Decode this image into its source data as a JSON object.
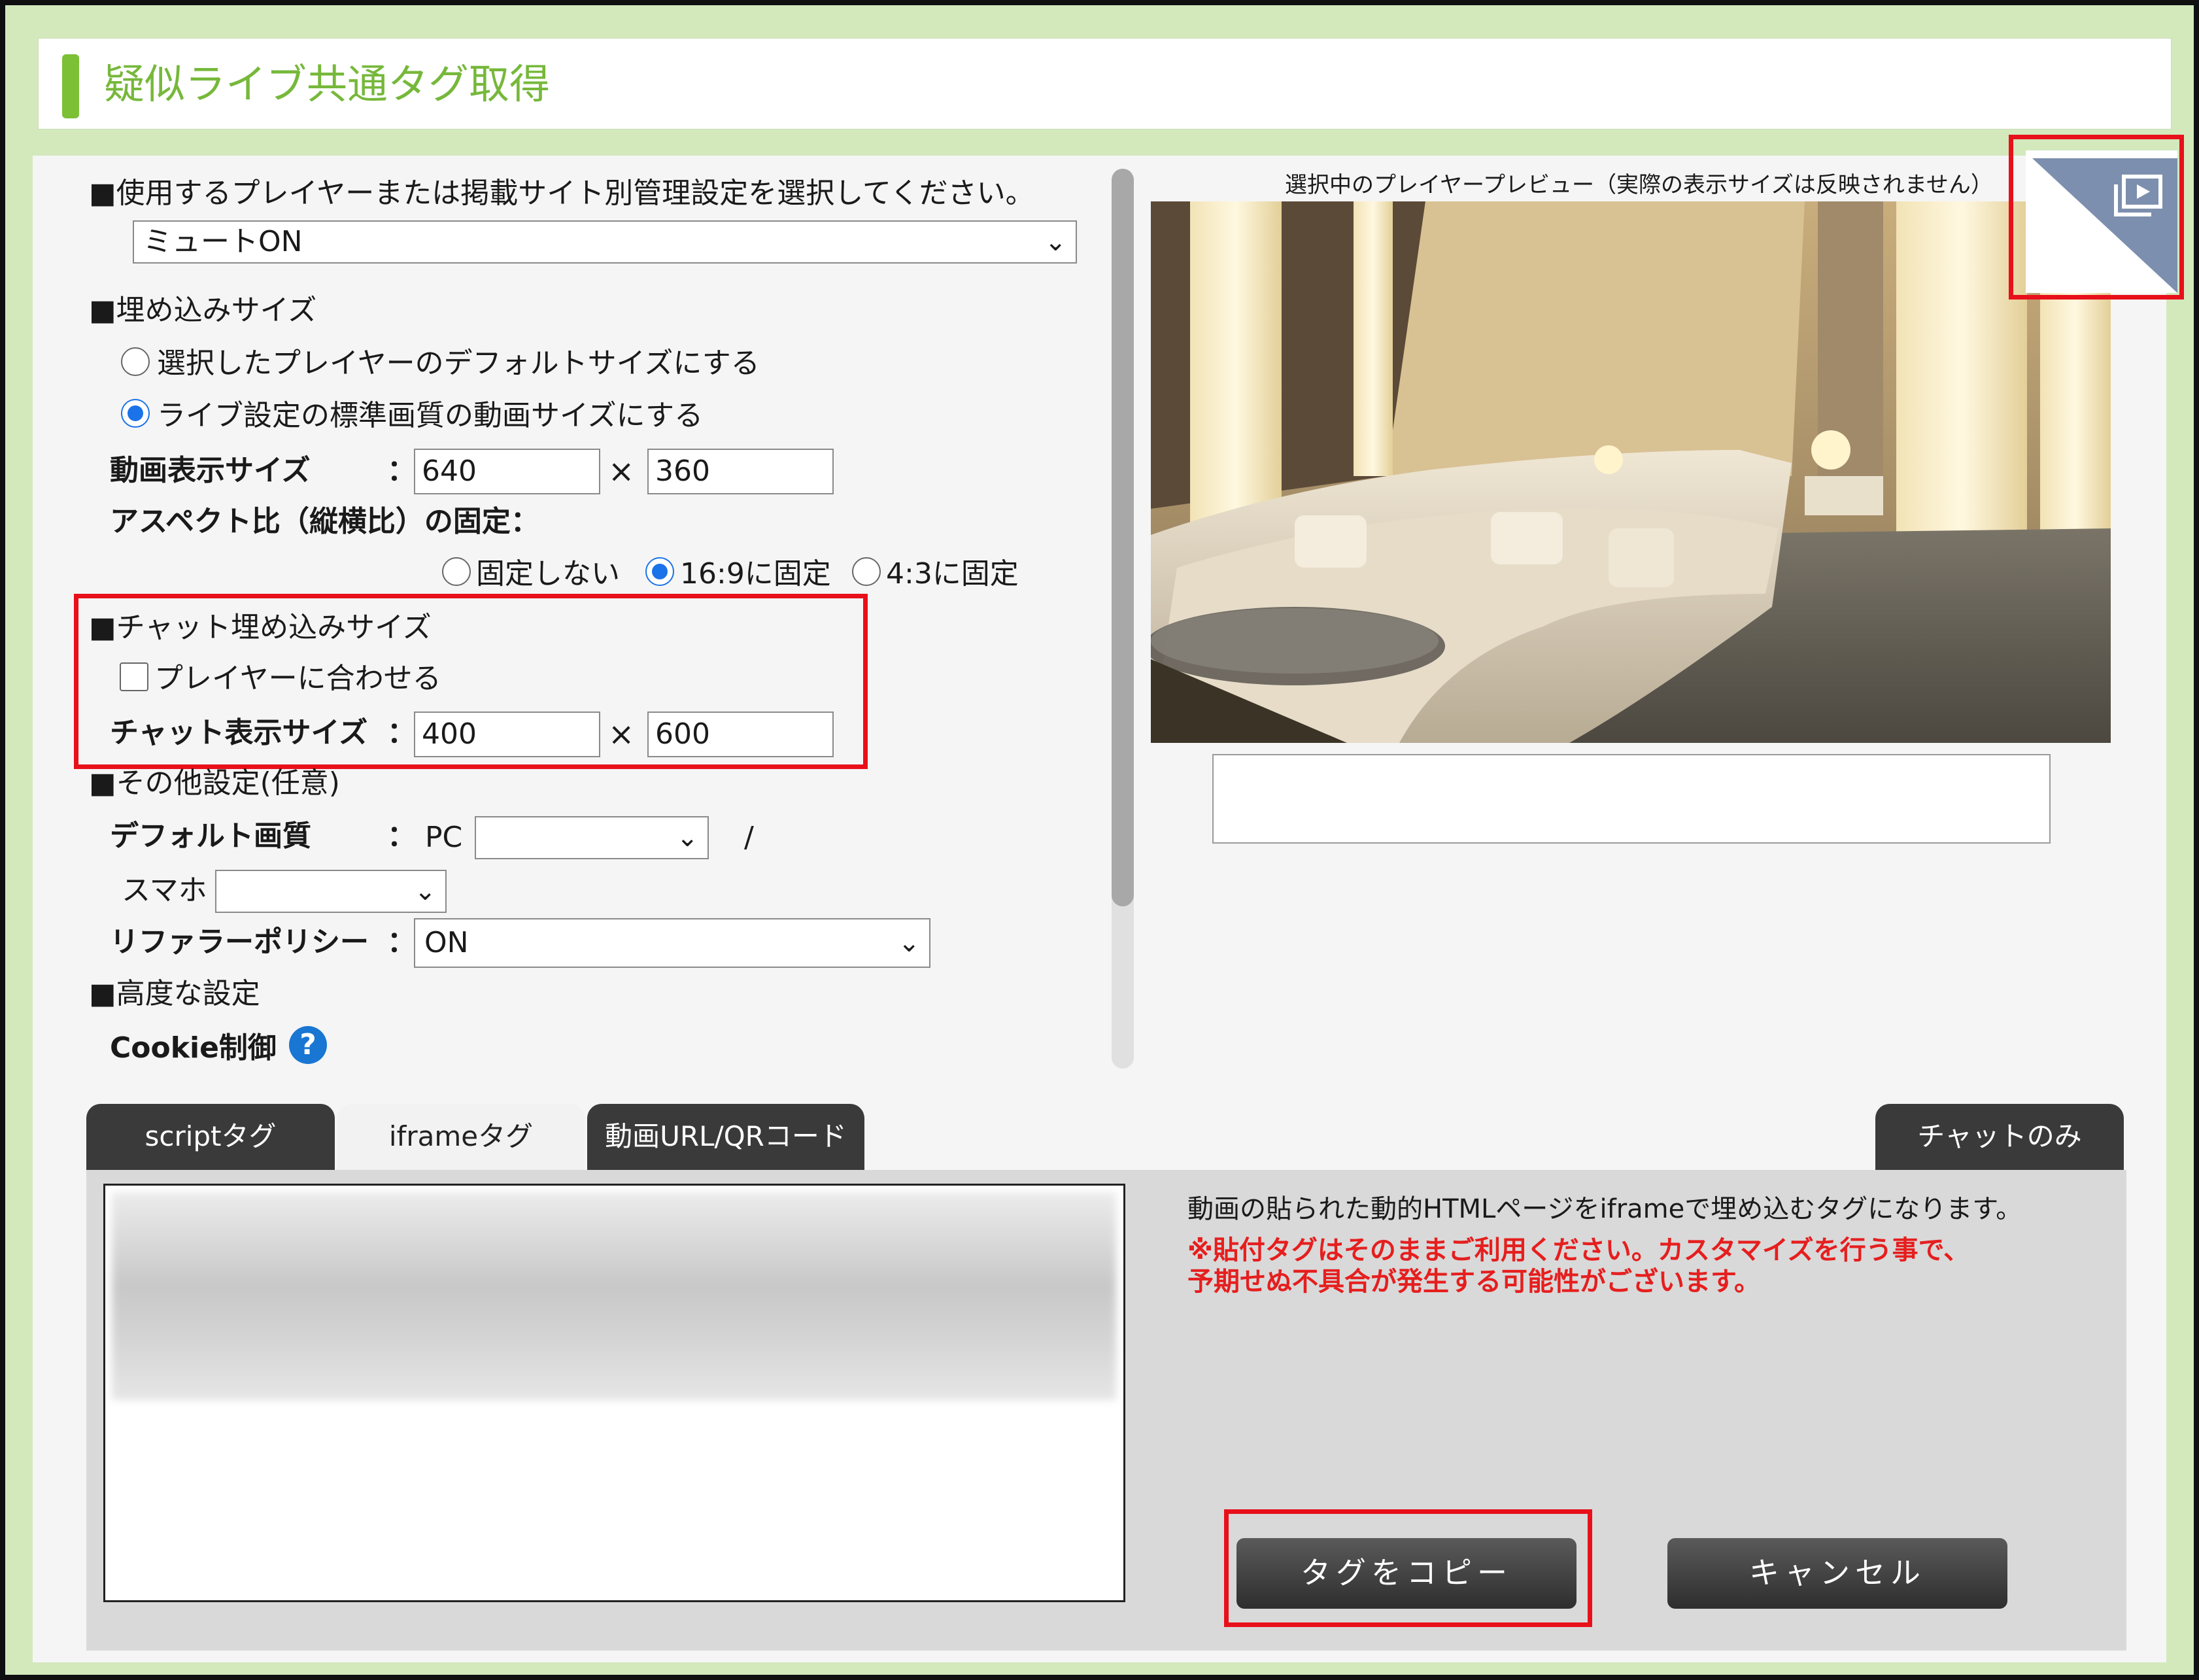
{
  "page": {
    "title": "疑似ライブ共通タグ取得"
  },
  "settings": {
    "player_heading": "■使用するプレイヤーまたは掲載サイト別管理設定を選択してください。",
    "player_select": "ミュートON",
    "embed_heading": "■埋め込みサイズ",
    "size_option_default": "選択したプレイヤーのデフォルトサイズにする",
    "size_option_live": "ライブ設定の標準画質の動画サイズにする",
    "video_size_label": "動画表示サイズ",
    "colon": "：",
    "times": "×",
    "video_width": "640",
    "video_height": "360",
    "aspect_label": "アスペクト比（縦横比）の固定：",
    "aspect_none": "固定しない",
    "aspect_169": "16:9に固定",
    "aspect_43": "4:3に固定",
    "chat_heading": "■チャット埋め込みサイズ",
    "chat_fit_label": "プレイヤーに合わせる",
    "chat_size_label": "チャット表示サイズ",
    "chat_width": "400",
    "chat_height": "600",
    "other_heading": "■その他設定(任意)",
    "default_quality_label": "デフォルト画質",
    "pc_label": "PC",
    "pc_select": "",
    "slash": "/",
    "smartphone_label": "スマホ",
    "smartphone_select": "",
    "referrer_label": "リファラーポリシー",
    "referrer_select": "ON",
    "advanced_heading": "■高度な設定",
    "cookie_label": "Cookie制御",
    "help_glyph": "?"
  },
  "preview": {
    "label": "選択中のプレイヤープレビュー（実際の表示サイズは反映されません）",
    "caption": "",
    "corner_icon": "playlist-play-icon"
  },
  "tabs": [
    {
      "label": "scriptタグ",
      "active": false
    },
    {
      "label": "iframeタグ",
      "active": true
    },
    {
      "label": "動画URL/QRコード",
      "active": false
    },
    {
      "label": "チャットのみ",
      "active": false
    }
  ],
  "tag_panel": {
    "description": "動画の貼られた動的HTMLページをiframeで埋め込むタグになります。",
    "warning_line1": "※貼付タグはそのままご利用ください。カスタマイズを行う事で、",
    "warning_line2": "予期せぬ不具合が発生する可能性がございます。",
    "copy_button": "タグをコピー",
    "cancel_button": "キャンセル"
  },
  "colors": {
    "frame_green": "#d3e9bc",
    "title_green": "#76b83a",
    "highlight_red": "#e8101a",
    "warning_red": "#e61e1e",
    "radio_blue": "#1a73e8"
  }
}
